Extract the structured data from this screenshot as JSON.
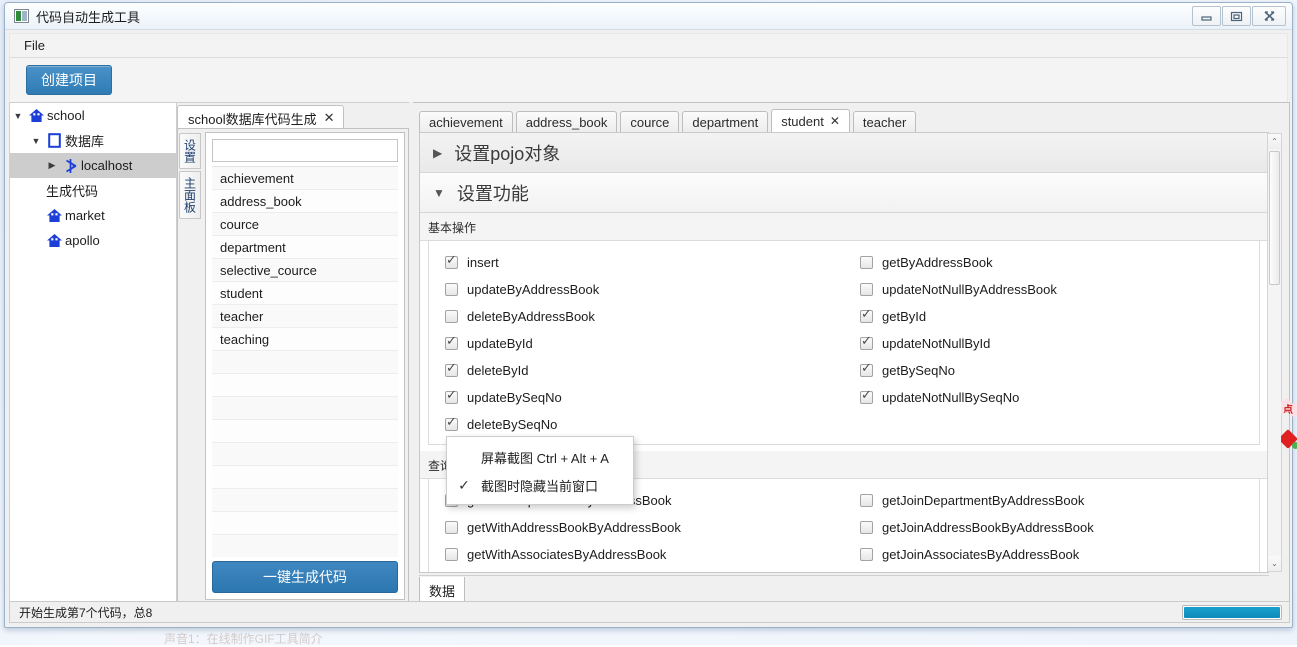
{
  "desktop": {
    "background_text": "声音1：在线制作GIF工具简介"
  },
  "window": {
    "title": "代码自动生成工具",
    "icon": "app-icon",
    "controls": [
      {
        "name": "minimize-button",
        "glyph": "minimize-icon"
      },
      {
        "name": "maximize-button",
        "glyph": "maximize-icon"
      },
      {
        "name": "close-button",
        "glyph": "close-icon"
      }
    ]
  },
  "menubar": {
    "items": [
      {
        "label": "File"
      }
    ]
  },
  "toolbar": {
    "create_project_label": "创建项目",
    "accent": "#2f7cb5"
  },
  "sidebar": {
    "items": [
      {
        "label": "school",
        "icon": "home-icon",
        "twisty": "▼",
        "indent": 0,
        "selected": false
      },
      {
        "label": "数据库",
        "icon": "database-icon",
        "twisty": "▼",
        "indent": 1,
        "selected": false
      },
      {
        "label": "localhost",
        "icon": "connection-icon",
        "twisty": "▶",
        "indent": 2,
        "selected": true
      },
      {
        "label": "生成代码",
        "icon": "none",
        "twisty": "",
        "indent": 1,
        "selected": false
      },
      {
        "label": "market",
        "icon": "home-icon",
        "twisty": "",
        "indent": 1,
        "selected": false
      },
      {
        "label": "apollo",
        "icon": "home-icon",
        "twisty": "",
        "indent": 1,
        "selected": false
      }
    ]
  },
  "table_panel": {
    "doc_tab": {
      "label": "school数据库代码生成",
      "close": "✕"
    },
    "vertical_tabs": [
      {
        "label": "设置"
      },
      {
        "label": "主面板"
      }
    ],
    "search": {
      "value": "",
      "placeholder": ""
    },
    "tables": [
      "achievement",
      "address_book",
      "cource",
      "department",
      "selective_cource",
      "student",
      "teacher",
      "teaching"
    ],
    "blank_rows": 10,
    "generate_button_label": "一键生成代码"
  },
  "content": {
    "tabs": [
      {
        "label": "achievement",
        "active": false,
        "closable": false
      },
      {
        "label": "address_book",
        "active": false,
        "closable": false
      },
      {
        "label": "cource",
        "active": false,
        "closable": false
      },
      {
        "label": "department",
        "active": false,
        "closable": false
      },
      {
        "label": "student",
        "active": true,
        "closable": true,
        "close": "✕"
      },
      {
        "label": "teacher",
        "active": false,
        "closable": false
      }
    ],
    "sections": [
      {
        "title": "设置pojo对象",
        "arrow": "▶",
        "expanded": false
      },
      {
        "title": "设置功能",
        "arrow": "▼",
        "expanded": true
      }
    ],
    "groups": [
      {
        "label": "基本操作",
        "rows": [
          {
            "left": {
              "label": "insert",
              "checked": true
            },
            "right": {
              "label": "getByAddressBook",
              "checked": false
            }
          },
          {
            "left": {
              "label": "updateByAddressBook",
              "checked": false
            },
            "right": {
              "label": "updateNotNullByAddressBook",
              "checked": false
            }
          },
          {
            "left": {
              "label": "deleteByAddressBook",
              "checked": false
            },
            "right": {
              "label": "getById",
              "checked": true
            }
          },
          {
            "left": {
              "label": "updateById",
              "checked": true
            },
            "right": {
              "label": "updateNotNullById",
              "checked": true
            }
          },
          {
            "left": {
              "label": "deleteById",
              "checked": true
            },
            "right": {
              "label": "getBySeqNo",
              "checked": true
            }
          },
          {
            "left": {
              "label": "updateBySeqNo",
              "checked": true
            },
            "right": {
              "label": "updateNotNullBySeqNo",
              "checked": true
            }
          },
          {
            "left": {
              "label": "deleteBySeqNo",
              "checked": true
            },
            "right": {
              "label": "",
              "checked": false
            }
          }
        ]
      },
      {
        "label": "查询多表",
        "rows": [
          {
            "left": {
              "label": "getWithDepartmentByAddressBook",
              "checked": false
            },
            "right": {
              "label": "getJoinDepartmentByAddressBook",
              "checked": false
            }
          },
          {
            "left": {
              "label": "getWithAddressBookByAddressBook",
              "checked": false
            },
            "right": {
              "label": "getJoinAddressBookByAddressBook",
              "checked": false
            }
          },
          {
            "left": {
              "label": "getWithAssociatesByAddressBook",
              "checked": false
            },
            "right": {
              "label": "getJoinAssociatesByAddressBook",
              "checked": false
            }
          }
        ]
      }
    ],
    "bottom_tab": {
      "label": "数据"
    },
    "scrollbar": {
      "up": "⌃",
      "down": "⌄"
    }
  },
  "context_menu": {
    "items": [
      {
        "label": "屏幕截图 Ctrl + Alt + A",
        "ticked": false
      },
      {
        "label": "截图时隐藏当前窗口",
        "ticked": true,
        "tick": "✓"
      }
    ]
  },
  "badge": {
    "text": "点",
    "color": "#c81616"
  },
  "statusbar": {
    "message": "开始生成第7个代码，总8",
    "progress_percent": 100,
    "progress_color": "#0f8cba"
  }
}
